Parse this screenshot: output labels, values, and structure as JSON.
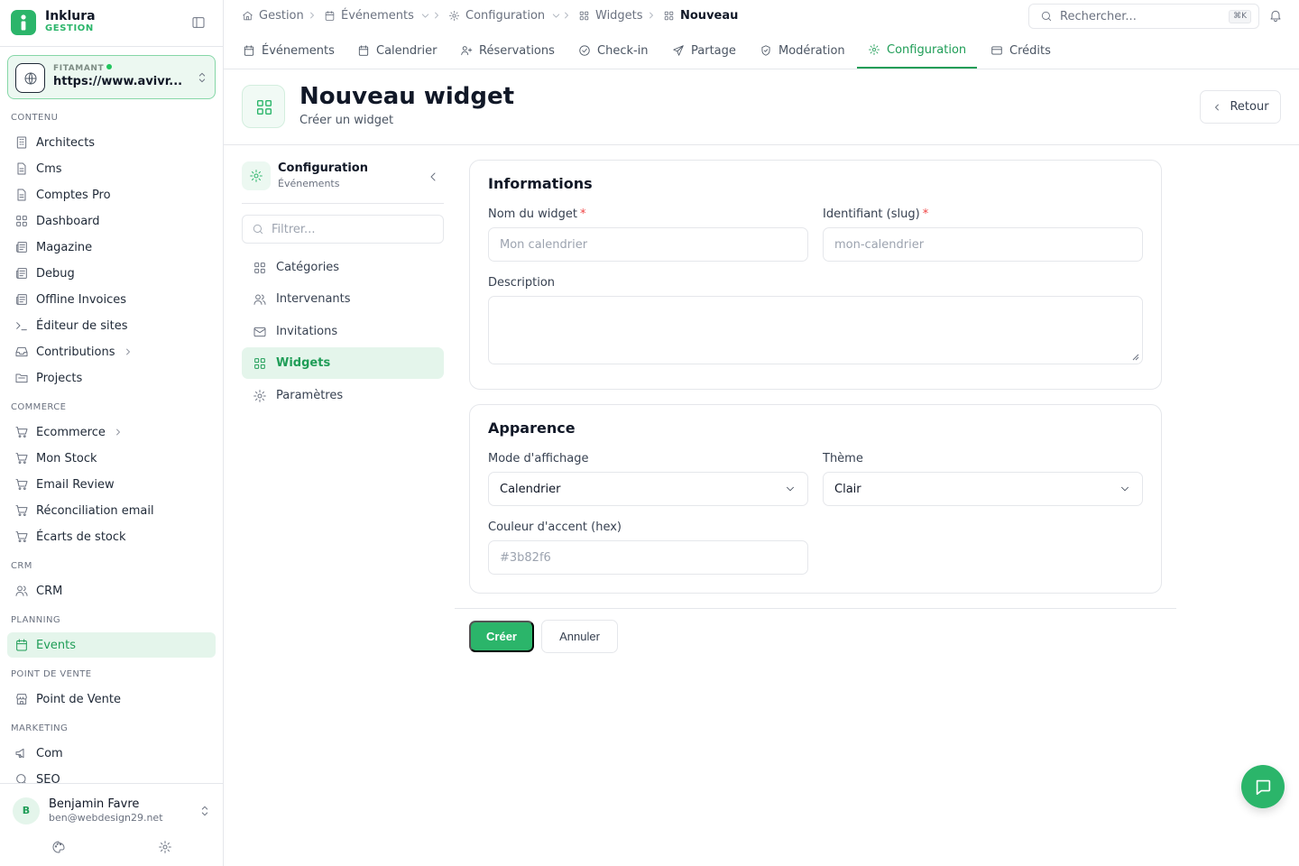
{
  "brand": {
    "name": "Inklura",
    "subtitle": "GESTION"
  },
  "org": {
    "label": "FITAMANT",
    "url": "https://www.avivr..."
  },
  "sidebar": {
    "sections": [
      {
        "title": "CONTENU",
        "items": [
          {
            "label": "Architects",
            "icon": "building-icon"
          },
          {
            "label": "Cms",
            "icon": "file-icon"
          },
          {
            "label": "Comptes Pro",
            "icon": "file-icon"
          },
          {
            "label": "Dashboard",
            "icon": "grid-icon"
          },
          {
            "label": "Magazine",
            "icon": "newspaper-icon"
          },
          {
            "label": "Debug",
            "icon": "newspaper-icon"
          },
          {
            "label": "Offline Invoices",
            "icon": "newspaper-icon"
          },
          {
            "label": "Éditeur de sites",
            "icon": "terminal-icon"
          },
          {
            "label": "Contributions",
            "icon": "inbox-icon",
            "expandable": true
          },
          {
            "label": "Projects",
            "icon": "folder-icon"
          }
        ]
      },
      {
        "title": "COMMERCE",
        "items": [
          {
            "label": "Ecommerce",
            "icon": "cart-icon",
            "expandable": true
          },
          {
            "label": "Mon Stock",
            "icon": "cart-icon"
          },
          {
            "label": "Email Review",
            "icon": "cart-icon"
          },
          {
            "label": "Réconciliation email",
            "icon": "cart-icon"
          },
          {
            "label": "Écarts de stock",
            "icon": "cart-icon"
          }
        ]
      },
      {
        "title": "CRM",
        "items": [
          {
            "label": "CRM",
            "icon": "users-icon"
          }
        ]
      },
      {
        "title": "PLANNING",
        "items": [
          {
            "label": "Events",
            "icon": "calendar-icon",
            "active": true
          }
        ]
      },
      {
        "title": "POINT DE VENTE",
        "items": [
          {
            "label": "Point de Vente",
            "icon": "store-icon"
          }
        ]
      },
      {
        "title": "MARKETING",
        "items": [
          {
            "label": "Com",
            "icon": "megaphone-icon"
          },
          {
            "label": "SEO",
            "icon": "search-icon"
          }
        ]
      }
    ]
  },
  "user": {
    "initial": "B",
    "name": "Benjamin Favre",
    "email": "ben@webdesign29.net"
  },
  "breadcrumb": [
    {
      "label": "Gestion",
      "icon": "home-icon"
    },
    {
      "label": "Événements",
      "icon": "calendar-icon",
      "dropdown": true
    },
    {
      "label": "Configuration",
      "icon": "gear-icon",
      "dropdown": true
    },
    {
      "label": "Widgets",
      "icon": "grid-icon"
    },
    {
      "label": "Nouveau",
      "icon": "grid-icon",
      "current": true
    }
  ],
  "search": {
    "placeholder": "Rechercher...",
    "shortcut": "⌘K"
  },
  "tabs": [
    {
      "label": "Événements",
      "icon": "calendar-icon"
    },
    {
      "label": "Calendrier",
      "icon": "calendar-icon"
    },
    {
      "label": "Réservations",
      "icon": "user-plus-icon"
    },
    {
      "label": "Check-in",
      "icon": "check-circle-icon"
    },
    {
      "label": "Partage",
      "icon": "send-icon"
    },
    {
      "label": "Modération",
      "icon": "shield-check-icon"
    },
    {
      "label": "Configuration",
      "icon": "gear-icon",
      "active": true
    },
    {
      "label": "Crédits",
      "icon": "credit-card-icon"
    }
  ],
  "page": {
    "title": "Nouveau widget",
    "subtitle": "Créer un widget",
    "back_label": "Retour"
  },
  "config_nav": {
    "title": "Configuration",
    "subtitle": "Événements",
    "filter_placeholder": "Filtrer...",
    "items": [
      {
        "label": "Catégories",
        "icon": "grid-icon"
      },
      {
        "label": "Intervenants",
        "icon": "users-icon"
      },
      {
        "label": "Invitations",
        "icon": "mail-icon"
      },
      {
        "label": "Widgets",
        "icon": "grid-icon",
        "active": true
      },
      {
        "label": "Paramètres",
        "icon": "gear-icon"
      }
    ]
  },
  "form": {
    "info": {
      "title": "Informations",
      "name_label": "Nom du widget",
      "name_placeholder": "Mon calendrier",
      "slug_label": "Identifiant (slug)",
      "slug_placeholder": "mon-calendrier",
      "required_mark": "*",
      "description_label": "Description",
      "description_value": ""
    },
    "appearance": {
      "title": "Apparence",
      "mode_label": "Mode d'affichage",
      "mode_value": "Calendrier",
      "theme_label": "Thème",
      "theme_value": "Clair",
      "accent_label": "Couleur d'accent (hex)",
      "accent_placeholder": "#3b82f6"
    }
  },
  "actions": {
    "create": "Créer",
    "cancel": "Annuler"
  },
  "colors": {
    "accent": "#2bb56a",
    "active_bg": "#e4f5eb",
    "required": "#ef4444"
  }
}
